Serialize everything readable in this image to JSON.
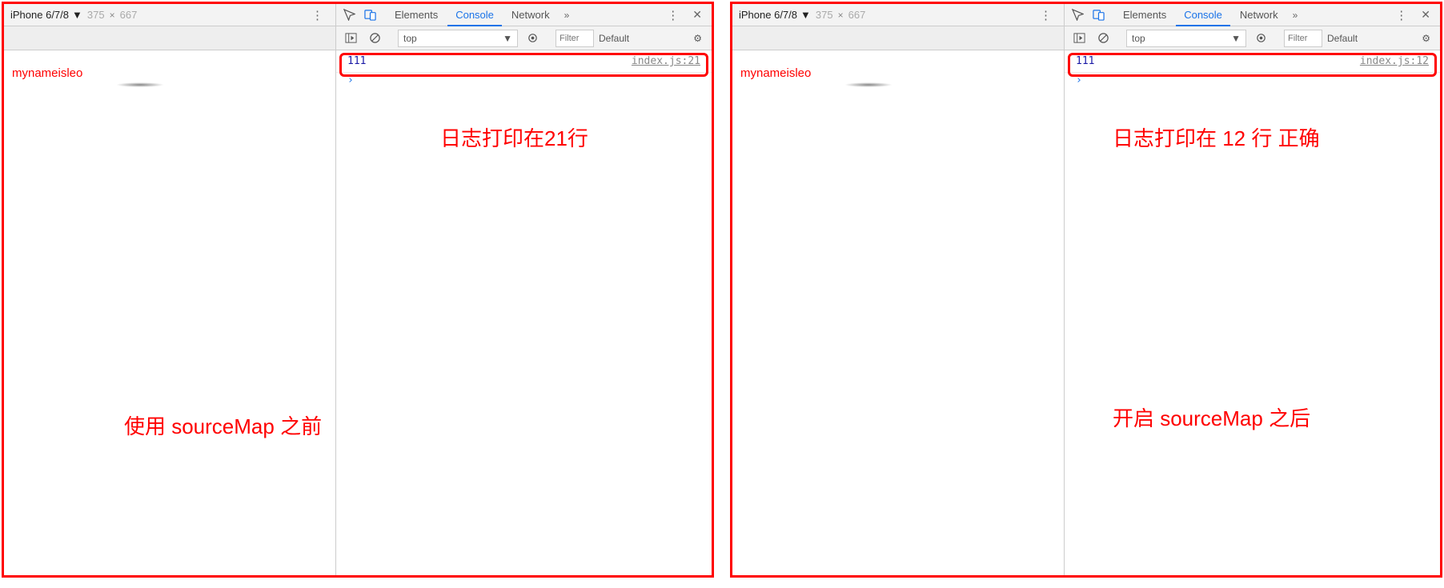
{
  "left": {
    "device_name": "iPhone 6/7/8",
    "width": "375",
    "height": "667",
    "tabs": {
      "elements": "Elements",
      "console": "Console",
      "network": "Network"
    },
    "console_context": "top",
    "filter_placeholder": "Filter",
    "level_label": "Default",
    "page_text": "mynameisleo",
    "log_value": "111",
    "log_source": "index.js:21",
    "annotation_line": "日志打印在21行",
    "annotation_main": "使用 sourceMap 之前"
  },
  "right": {
    "device_name": "iPhone 6/7/8",
    "width": "375",
    "height": "667",
    "tabs": {
      "elements": "Elements",
      "console": "Console",
      "network": "Network"
    },
    "console_context": "top",
    "filter_placeholder": "Filter",
    "level_label": "Default",
    "page_text": "mynameisleo",
    "log_value": "111",
    "log_source": "index.js:12",
    "annotation_line": "日志打印在 12 行 正确",
    "annotation_main": "开启 sourceMap 之后"
  }
}
